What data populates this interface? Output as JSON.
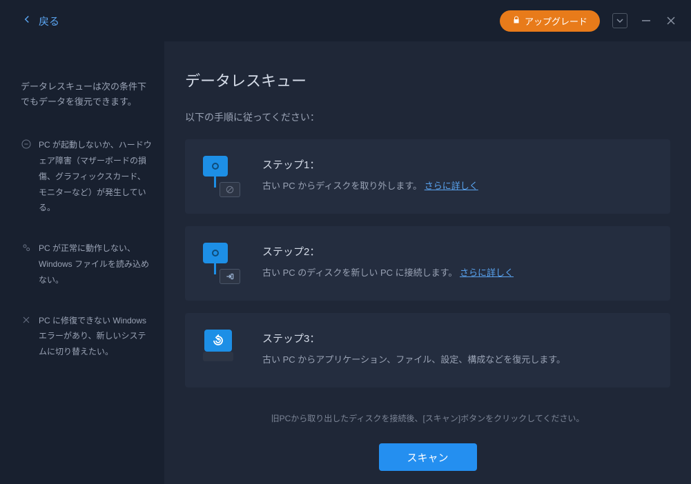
{
  "titlebar": {
    "back_label": "戻る",
    "upgrade_label": "アップグレード"
  },
  "sidebar": {
    "intro": "データレスキューは次の条件下でもデータを復元できます。",
    "items": [
      {
        "text": "PC が起動しないか、ハードウェア障害（マザーボードの損傷、グラフィックスカード、モニターなど）が発生している。"
      },
      {
        "text": "PC が正常に動作しない、Windows ファイルを読み込めない。"
      },
      {
        "text": "PC に修復できない Windows エラーがあり、新しいシステムに切り替えたい。"
      }
    ]
  },
  "main": {
    "title": "データレスキュー",
    "subtitle": "以下の手順に従ってください：",
    "steps": [
      {
        "title": "ステップ1：",
        "desc": "古い PC からディスクを取り外します。",
        "link": "さらに詳しく"
      },
      {
        "title": "ステップ2：",
        "desc": "古い PC のディスクを新しい PC に接続します。",
        "link": "さらに詳しく"
      },
      {
        "title": "ステップ3：",
        "desc": "古い PC からアプリケーション、ファイル、設定、構成などを復元します。",
        "link": ""
      }
    ],
    "hint": "旧PCから取り出したディスクを接続後、[スキャン]ボタンをクリックしてください。",
    "scan_label": "スキャン"
  }
}
